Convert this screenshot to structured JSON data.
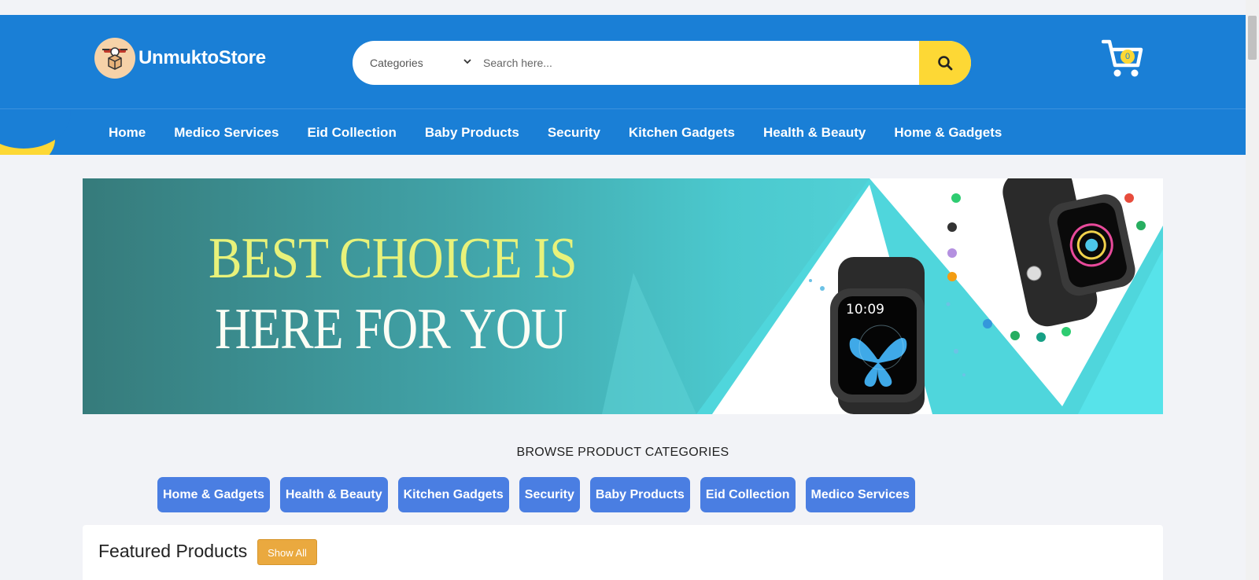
{
  "header": {
    "brand": "UnmuktoStore",
    "search": {
      "category_label": "Categories",
      "placeholder": "Search here..."
    },
    "cart_count": "0"
  },
  "nav": {
    "items": [
      "Home",
      "Medico Services",
      "Eid Collection",
      "Baby Products",
      "Security",
      "Kitchen Gadgets",
      "Health & Beauty",
      "Home & Gadgets"
    ]
  },
  "banner": {
    "line1": "BEST CHOICE IS",
    "line2": "HERE FOR YOU",
    "watch_time": "10:09"
  },
  "categories": {
    "title": "BROWSE PRODUCT CATEGORIES",
    "items": [
      "Home & Gadgets",
      "Health & Beauty",
      "Kitchen Gadgets",
      "Security",
      "Baby Products",
      "Eid Collection",
      "Medico Services"
    ]
  },
  "featured": {
    "title": "Featured Products",
    "show_all": "Show All"
  },
  "colors": {
    "primary": "#1a7fd6",
    "accent": "#fdd835",
    "pill": "#4a7ee2",
    "show_all": "#eaa93f"
  }
}
